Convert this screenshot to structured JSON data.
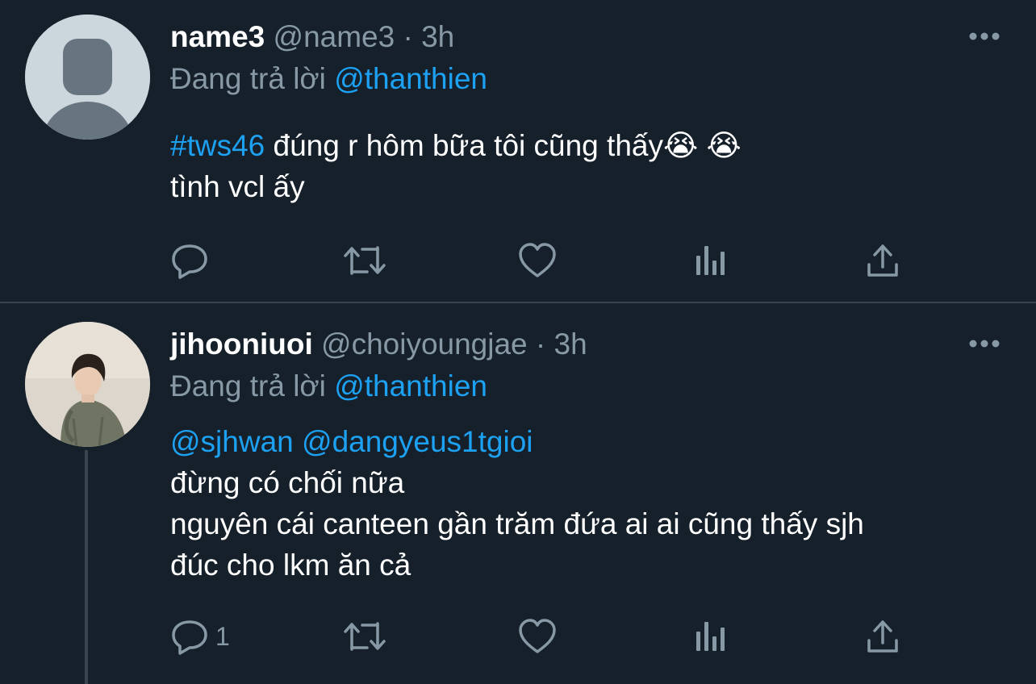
{
  "tweets": [
    {
      "display_name": "name3",
      "handle": "@name3",
      "separator": "·",
      "time": "3h",
      "reply_prefix": "Đang trả lời",
      "reply_to": "@thanthien",
      "text_lines": [
        {
          "hashtag": "#tws46",
          "rest": " đúng r hôm bữa tôi cũng thấy😭 😭"
        },
        {
          "hashtag": "",
          "rest": "tình vcl ấy"
        }
      ],
      "reply_count": "",
      "avatar": "default-avatar"
    },
    {
      "display_name": "jihooniuoi",
      "handle": "@choiyoungjae",
      "separator": "·",
      "time": "3h",
      "reply_prefix": "Đang trả lời",
      "reply_to": "@thanthien",
      "mentions": "@sjhwan @dangyeus1tgioi",
      "text_lines": [
        "đừng có chối nữa",
        "nguyên cái canteen gần trăm đứa ai ai cũng thấy sjh",
        "đúc cho lkm ăn cả"
      ],
      "reply_count": "1",
      "avatar": "user-photo-avatar"
    }
  ],
  "icons": {
    "reply": "reply-icon",
    "retweet": "retweet-icon",
    "like": "heart-icon",
    "analytics": "analytics-icon",
    "share": "share-icon",
    "more": "more-icon"
  },
  "colors": {
    "background": "#15202b",
    "link": "#1da1f2",
    "secondary_text": "#8899a6",
    "divider": "#38444d"
  }
}
